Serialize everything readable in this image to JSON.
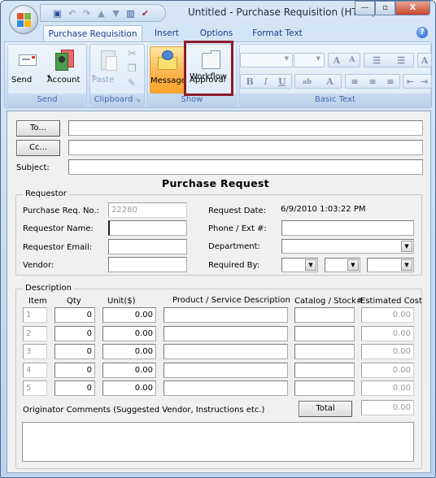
{
  "window": {
    "title": "Untitled - Purchase Requisition (HTML)",
    "controls": {
      "minimize": "—",
      "maximize": "▫",
      "close": "X"
    }
  },
  "quick_access": [
    "save-icon",
    "undo-icon",
    "redo-icon",
    "up-icon",
    "down-icon",
    "address-book-icon",
    "check-names-icon"
  ],
  "tabs": [
    {
      "label": "Purchase Requisition",
      "active": true
    },
    {
      "label": "Insert",
      "active": false
    },
    {
      "label": "Options",
      "active": false
    },
    {
      "label": "Format Text",
      "active": false
    }
  ],
  "help_label": "?",
  "ribbon": {
    "groups": {
      "send": {
        "label": "Send",
        "send": "Send",
        "account": "Account",
        "account_arrow": "▾"
      },
      "clipboard": {
        "label": "Clipboard",
        "paste": "Paste",
        "paste_arrow": "▾"
      },
      "show": {
        "label": "Show",
        "message": "Message",
        "approval_line1": "Approval",
        "approval_line2": "Workflow"
      },
      "basic_text": {
        "label": "Basic Text",
        "bold": "B",
        "italic": "I",
        "underline": "U",
        "grow": "A",
        "shrink": "A",
        "highlight": "ab",
        "font_color": "A"
      }
    }
  },
  "form": {
    "to_button": "To...",
    "cc_button": "Cc...",
    "subject_label": "Subject:",
    "to_value": "",
    "cc_value": "",
    "subject_value": "",
    "heading": "Purchase Request",
    "requestor": {
      "legend": "Requestor",
      "req_no_label": "Purchase Req. No.:",
      "req_no_value": "22280",
      "name_label": "Requestor Name:",
      "name_value": "",
      "email_label": "Requestor Email:",
      "email_value": "",
      "vendor_label": "Vendor:",
      "vendor_value": "",
      "date_label": "Request Date:",
      "date_value": "6/9/2010 1:03:22 PM",
      "phone_label": "Phone / Ext #:",
      "phone_value": "",
      "department_label": "Department:",
      "department_value": "",
      "required_by_label": "Required By:",
      "dropdown_arrow": "▼"
    },
    "description": {
      "legend": "Description",
      "columns": [
        "Item",
        "Qty",
        "Unit($)",
        "Product / Service Description",
        "Catalog / Stock#",
        "Estimated Cost"
      ],
      "rows": [
        {
          "item": "1",
          "qty": "0",
          "unit": "0.00",
          "product": "",
          "catalog": "",
          "cost": "0.00"
        },
        {
          "item": "2",
          "qty": "0",
          "unit": "0.00",
          "product": "",
          "catalog": "",
          "cost": "0.00"
        },
        {
          "item": "3",
          "qty": "0",
          "unit": "0.00",
          "product": "",
          "catalog": "",
          "cost": "0.00"
        },
        {
          "item": "4",
          "qty": "0",
          "unit": "0.00",
          "product": "",
          "catalog": "",
          "cost": "0.00"
        },
        {
          "item": "5",
          "qty": "0",
          "unit": "0.00",
          "product": "",
          "catalog": "",
          "cost": "0.00"
        }
      ],
      "comments_label": "Originator Comments (Suggested Vendor, Instructions etc.)",
      "total_button": "Total",
      "total_value": "0.00",
      "comments_value": ""
    }
  }
}
